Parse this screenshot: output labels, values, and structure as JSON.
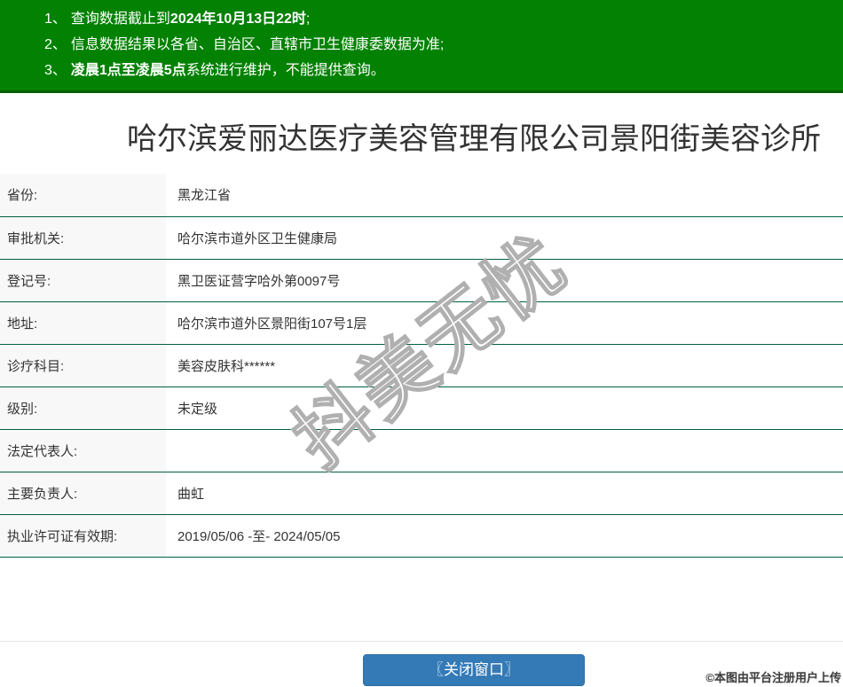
{
  "notices": [
    {
      "num": "1、",
      "pre": "查询数据截止到",
      "bold": "2024年10月13日22时",
      "post": ";"
    },
    {
      "num": "2、",
      "pre": "信息数据结果以各省、自治区、直辖市卫生健康委数据为准;",
      "bold": "",
      "post": ""
    },
    {
      "num": "3、",
      "pre": "",
      "bold": "凌晨1点至凌晨5点",
      "post": "系统进行维护，不能提供查询。"
    }
  ],
  "title": "哈尔滨爱丽达医疗美容管理有限公司景阳街美容诊所",
  "table": {
    "rows": [
      {
        "label": "省份:",
        "value": "黑龙江省"
      },
      {
        "label": "审批机关:",
        "value": "哈尔滨市道外区卫生健康局"
      },
      {
        "label": "登记号:",
        "value": "黑卫医证营字哈外第0097号"
      },
      {
        "label": "地址:",
        "value": "哈尔滨市道外区景阳街107号1层"
      },
      {
        "label": "诊疗科目:",
        "value": "美容皮肤科******"
      },
      {
        "label": "级别:",
        "value": "未定级"
      },
      {
        "label": "法定代表人:",
        "value": ""
      },
      {
        "label": "主要负责人:",
        "value": "曲虹"
      },
      {
        "label": "执业许可证有效期:",
        "value": "2019/05/06 -至- 2024/05/05"
      }
    ]
  },
  "watermark_text": "抖美无忧",
  "footer": {
    "close_button_label": "〖关闭窗口〗",
    "copyright": "©本图由平台注册用户上传"
  },
  "colors": {
    "banner_green": "#028102",
    "banner_border_green": "#015c01",
    "table_border_green": "#01613d",
    "label_column_bg": "#f8f8f8",
    "button_blue": "#337ab7",
    "watermark_stroke": "#b0b0b0"
  }
}
